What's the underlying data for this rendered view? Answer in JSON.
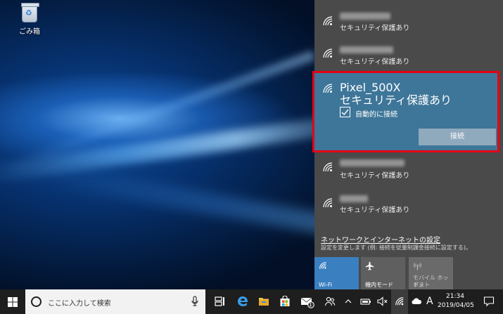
{
  "desktop": {
    "recycle_bin_label": "ごみ箱"
  },
  "network_list": {
    "network_1": {
      "security": "セキュリティ保護あり"
    },
    "network_2": {
      "security": "セキュリティ保護あり"
    },
    "selected": {
      "ssid": "Pixel_500X",
      "security": "セキュリティ保護あり",
      "auto_connect_label": "自動的に接続",
      "auto_connect_checked": true,
      "connect_button": "接続"
    },
    "network_4": {
      "security": "セキュリティ保護あり"
    },
    "network_5": {
      "security": "セキュリティ保護あり"
    }
  },
  "settings": {
    "link": "ネットワークとインターネットの設定",
    "description": "設定を変更します (例: 接続を従量制課金接続に設定する)。"
  },
  "quick_actions": [
    {
      "label": "Wi-Fi",
      "active": true,
      "icon": "wifi-icon"
    },
    {
      "label": "機内モード",
      "active": false,
      "icon": "airplane-icon"
    },
    {
      "label_line1": "モバイル ホットス",
      "label_line2": "ポット",
      "active": false,
      "disabled": true,
      "icon": "hotspot-icon"
    }
  ],
  "taskbar": {
    "search_placeholder": "ここに入力して検索",
    "ime_mode": "A",
    "time": "21:34",
    "date": "2019/04/05",
    "mail_badge": "1"
  },
  "colors": {
    "accent": "#3e7699",
    "highlight_border": "#e50012",
    "tile_active": "#3a7fc0",
    "flyout_bg": "#4a4a4a"
  }
}
